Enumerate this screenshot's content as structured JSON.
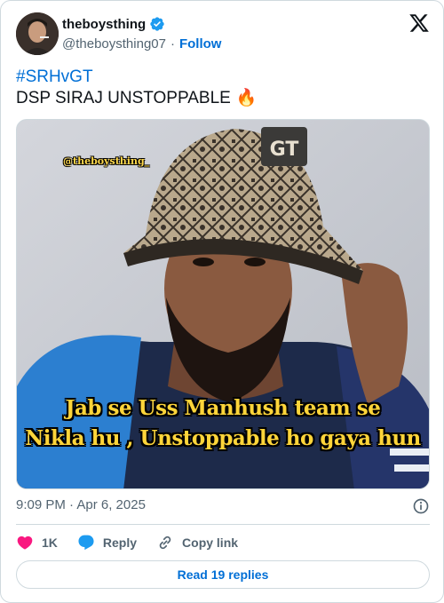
{
  "author": {
    "display_name": "theboysthing",
    "handle": "@theboysthing07",
    "separator": "·",
    "follow_label": "Follow",
    "verified_color": "#1d9bf0"
  },
  "tweet": {
    "hashtag": "#SRHvGT",
    "text": "DSP SIRAJ UNSTOPPABLE",
    "emoji": "🔥"
  },
  "media": {
    "watermark": "@theboysthing_",
    "caption_line1": "Jab se Uss Manhush team se",
    "caption_line2": "Nikla hu , Unstoppable ho gaya hun",
    "cap_logo_text": "GT"
  },
  "meta": {
    "timestamp": "9:09 PM · Apr 6, 2025"
  },
  "actions": {
    "like_count": "1K",
    "reply_label": "Reply",
    "copy_label": "Copy link"
  },
  "read_replies_label": "Read 19 replies",
  "colors": {
    "link": "#006fd6",
    "like": "#f91880",
    "caption": "#ffd53a"
  }
}
